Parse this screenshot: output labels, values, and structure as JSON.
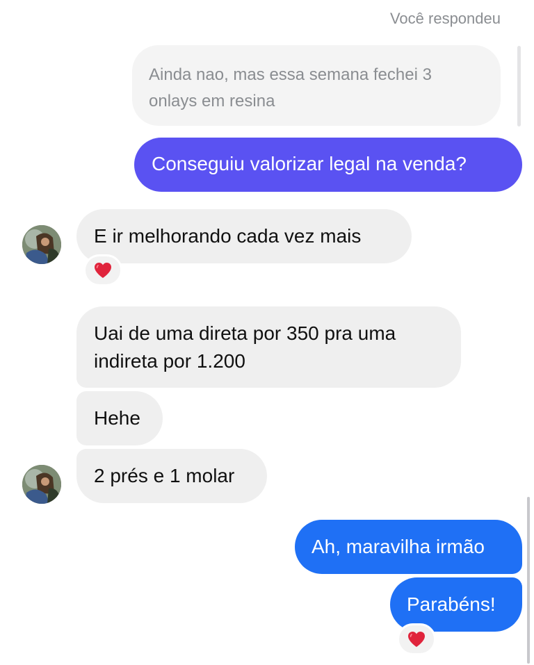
{
  "reply_context": {
    "label": "Você respondeu",
    "quoted_text": "Ainda nao, mas essa semana fechei 3 onlays em resina"
  },
  "messages": [
    {
      "direction": "outgoing",
      "text": "Conseguiu valorizar legal na venda?"
    },
    {
      "direction": "incoming",
      "text": "E ir melhorando cada vez mais",
      "reaction": "heart"
    },
    {
      "direction": "incoming",
      "text": "Uai de uma direta por 350 pra uma indireta por 1.200"
    },
    {
      "direction": "incoming",
      "text": "Hehe"
    },
    {
      "direction": "incoming",
      "text": "2 prés e 1 molar"
    },
    {
      "direction": "outgoing",
      "text": "Ah, maravilha irmão"
    },
    {
      "direction": "outgoing",
      "text": "Parabéns!",
      "reaction": "heart"
    }
  ],
  "text_lines": {
    "quoted_line1": "Ainda nao, mas essa semana fechei 3",
    "quoted_line2": "onlays em resina",
    "msg3_line1": "Uai de uma direta por 350 pra uma",
    "msg3_line2": "indireta por 1.200"
  },
  "colors": {
    "outgoing_purple": "#5a52f2",
    "outgoing_blue": "#1f70f5",
    "incoming_bg": "#efefef",
    "reaction_heart": "#e0243c"
  },
  "icons": {
    "reaction": "heart-icon",
    "avatar": "user-avatar"
  }
}
